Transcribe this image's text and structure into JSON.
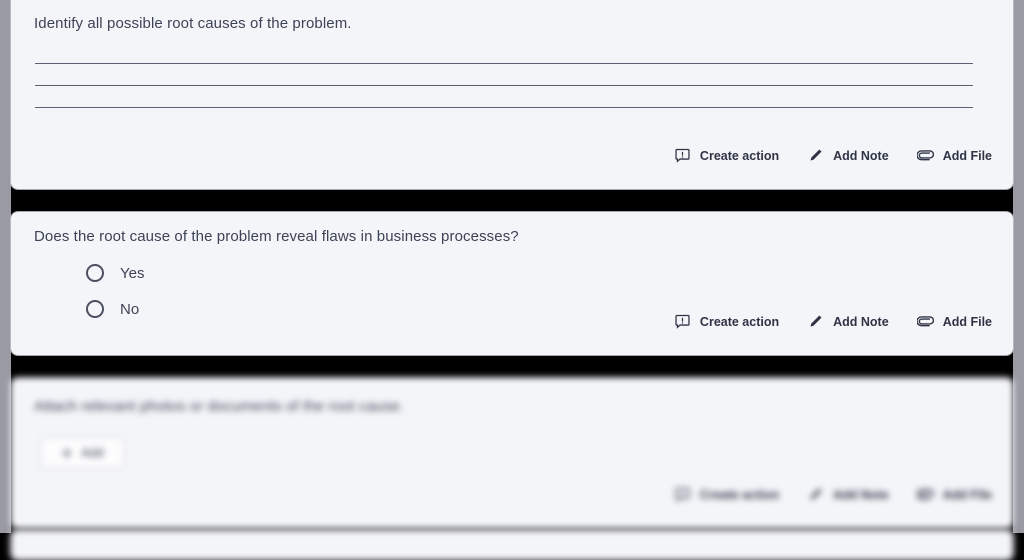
{
  "page": {
    "background_color": "#000000",
    "gutter_color": "#9a9aa2",
    "card_color": "#f4f5f9",
    "text_color": "#3d4356"
  },
  "action_bar": {
    "create_action": {
      "label": "Create action",
      "icon": "comment-alert-icon"
    },
    "add_note": {
      "label": "Add Note",
      "icon": "pencil-icon"
    },
    "add_file": {
      "label": "Add File",
      "icon": "paperclip-icon"
    }
  },
  "cards": [
    {
      "id": "root-cause-text-card",
      "question": "Identify all possible root causes of the problem.",
      "answer_lines": [
        "",
        "",
        ""
      ]
    },
    {
      "id": "business-process-flaws-card",
      "question": "Does the root cause of the problem reveal flaws in business processes?",
      "options": [
        {
          "label": "Yes",
          "selected": false
        },
        {
          "label": "No",
          "selected": false
        }
      ]
    },
    {
      "id": "attachments-card",
      "question": "Attach relevant photos or documents of the root cause.",
      "add_button": {
        "label": "Add",
        "icon": "plus-icon"
      },
      "blurred": true
    }
  ]
}
